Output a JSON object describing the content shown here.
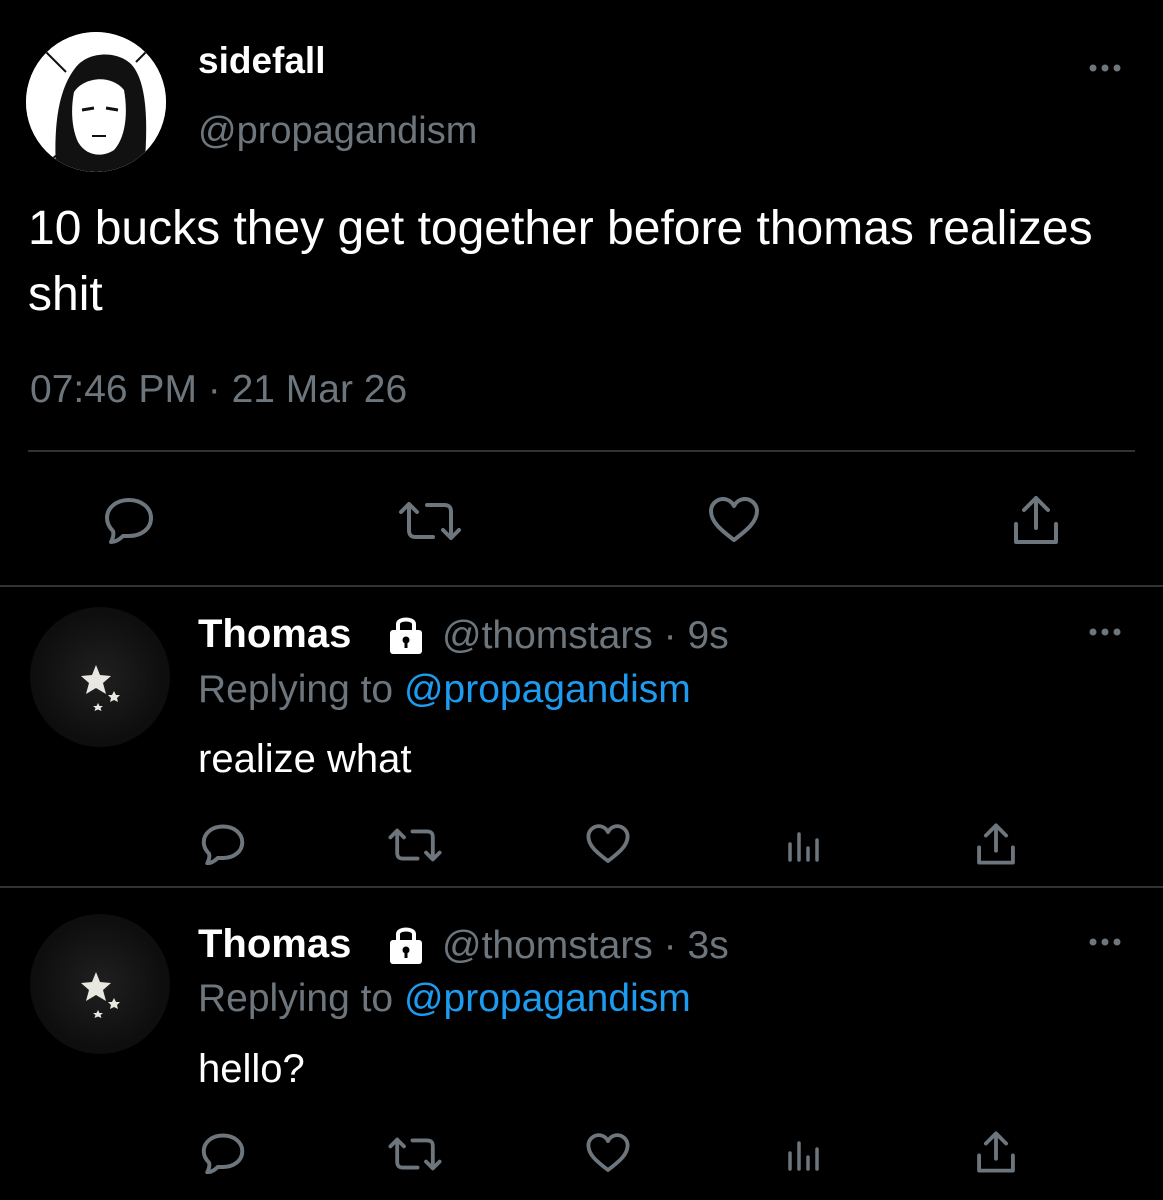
{
  "main_tweet": {
    "display_name": "sidefall",
    "handle": "@propagandism",
    "text": "10 bucks they get together before thomas realizes shit",
    "timestamp": "07:46 PM · 21 Mar 26",
    "more_icon": "more-dots-icon",
    "actions": [
      "reply-icon",
      "retweet-icon",
      "like-icon",
      "share-icon"
    ]
  },
  "replies": [
    {
      "display_name": "Thomas",
      "handle": "@thomstars",
      "time_sep": "·",
      "time": "9s",
      "replying_label": "Replying to",
      "replying_handle": "@propagandism",
      "text": "realize what",
      "locked_icon": "lock-icon",
      "actions": [
        "reply-icon",
        "retweet-icon",
        "like-icon",
        "analytics-icon",
        "share-icon"
      ]
    },
    {
      "display_name": "Thomas",
      "handle": "@thomstars",
      "time_sep": "·",
      "time": "3s",
      "replying_label": "Replying to",
      "replying_handle": "@propagandism",
      "text": "hello?",
      "locked_icon": "lock-icon",
      "actions": [
        "reply-icon",
        "retweet-icon",
        "like-icon",
        "analytics-icon",
        "share-icon"
      ]
    }
  ],
  "colors": {
    "background": "#000000",
    "text": "#ffffff",
    "muted": "#6e767d",
    "link": "#1d9bf0",
    "divider": "#2f3336"
  }
}
